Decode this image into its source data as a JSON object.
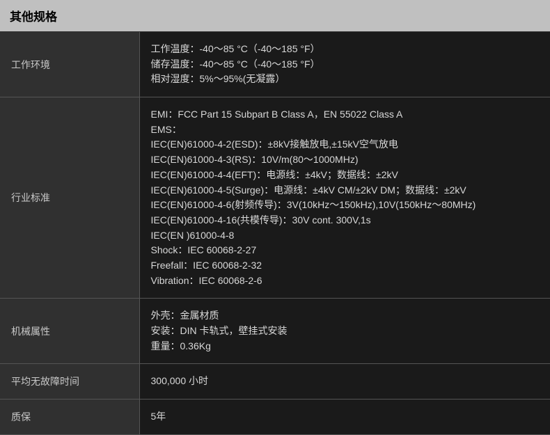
{
  "header": {
    "title": "其他规格"
  },
  "rows": [
    {
      "label": "工作环境",
      "lines": [
        "工作温度：-40～85 °C（-40～185 °F）",
        "储存温度：-40～85 °C（-40～185 °F）",
        "相对湿度：5%～95%(无凝露）"
      ]
    },
    {
      "label": "行业标准",
      "lines": [
        "EMI：FCC Part 15 Subpart B Class A，EN 55022 Class A",
        "EMS：",
        "IEC(EN)61000-4-2(ESD)：±8kV接触放电,±15kV空气放电",
        "IEC(EN)61000-4-3(RS)：10V/m(80～1000MHz)",
        "IEC(EN)61000-4-4(EFT)：电源线：±4kV；数据线：±2kV",
        "IEC(EN)61000-4-5(Surge)：电源线：±4kV CM/±2kV DM；数据线：±2kV",
        "IEC(EN)61000-4-6(射频传导)：3V(10kHz～150kHz),10V(150kHz～80MHz)",
        "IEC(EN)61000-4-16(共模传导)：30V cont. 300V,1s",
        "IEC(EN )61000-4-8",
        "Shock：IEC 60068-2-27",
        "Freefall：IEC 60068-2-32",
        "Vibration：IEC 60068-2-6"
      ]
    },
    {
      "label": "机械属性",
      "lines": [
        "外壳：金属材质",
        "安装：DIN 卡轨式，壁挂式安装",
        "重量：0.36Kg"
      ]
    },
    {
      "label": "平均无故障时间",
      "lines": [
        "300,000 小时"
      ]
    },
    {
      "label": "质保",
      "lines": [
        "5年"
      ]
    }
  ]
}
